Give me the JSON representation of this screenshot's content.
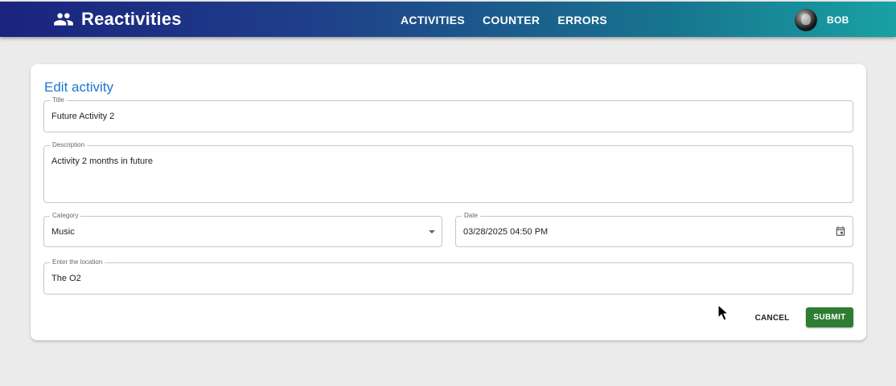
{
  "app": {
    "title": "Reactivities",
    "logo_icon": "group-icon"
  },
  "nav": {
    "items": [
      "ACTIVITIES",
      "COUNTER",
      "ERRORS"
    ]
  },
  "user": {
    "name": "BOB",
    "avatar_icon": "avatar-photo"
  },
  "form": {
    "heading": "Edit activity",
    "title": {
      "label": "Title",
      "value": "Future Activity 2"
    },
    "description": {
      "label": "Description",
      "value": "Activity 2 months in future"
    },
    "category": {
      "label": "Category",
      "value": "Music",
      "icon": "dropdown-arrow-icon"
    },
    "date": {
      "label": "Date",
      "value": "03/28/2025 04:50 PM",
      "icon": "calendar-icon"
    },
    "location": {
      "label": "Enter the location",
      "value": "The O2"
    },
    "cancel_label": "CANCEL",
    "submit_label": "SUBMIT"
  },
  "colors": {
    "accent": "#1976d2",
    "submit": "#2e7d32",
    "appbar_start": "#1a237e",
    "appbar_end": "#19a1a4"
  }
}
